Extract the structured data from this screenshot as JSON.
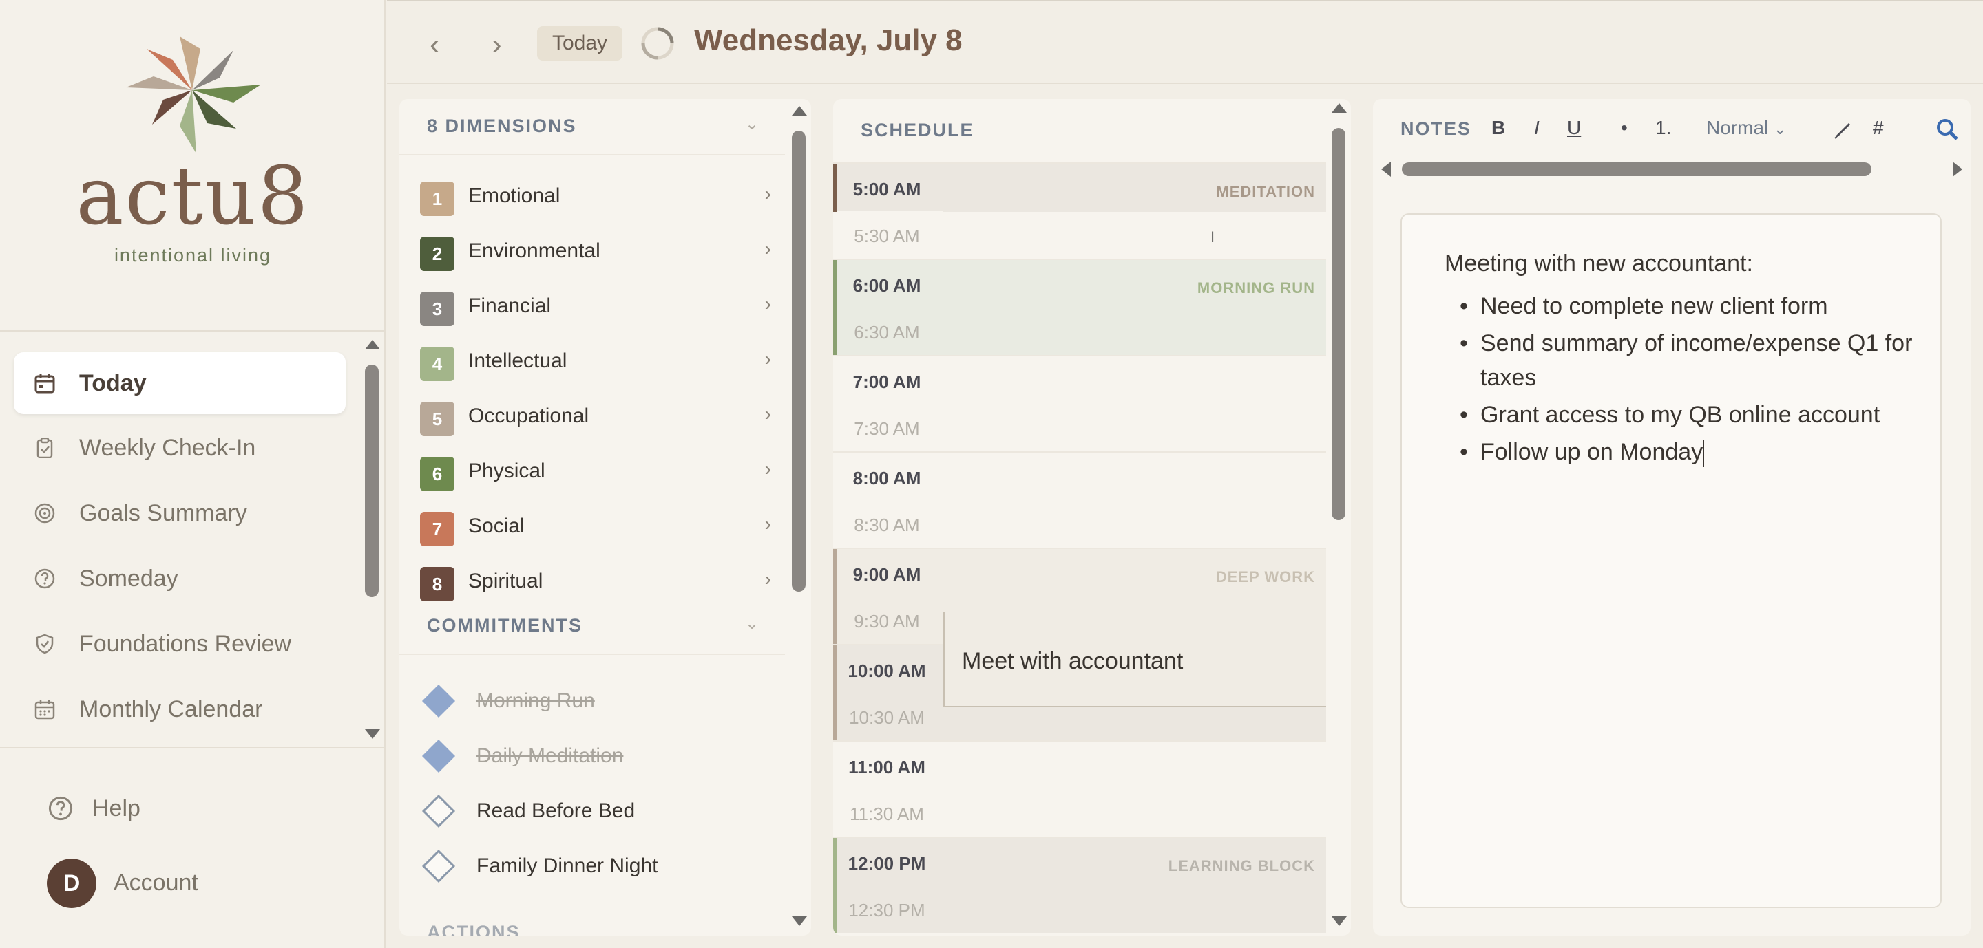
{
  "brand": {
    "name": "actu8",
    "tagline": "intentional living"
  },
  "sidebar": {
    "nav": [
      {
        "label": "Today",
        "icon": "calendar-icon",
        "active": true
      },
      {
        "label": "Weekly Check-In",
        "icon": "clipboard-check-icon"
      },
      {
        "label": "Goals Summary",
        "icon": "target-icon"
      },
      {
        "label": "Someday",
        "icon": "question-circle-icon"
      },
      {
        "label": "Foundations Review",
        "icon": "shield-check-icon"
      },
      {
        "label": "Monthly Calendar",
        "icon": "calendar-grid-icon"
      }
    ],
    "help": "Help",
    "account": "Account",
    "avatar_initial": "D"
  },
  "topbar": {
    "prev": "‹",
    "next": "›",
    "today": "Today",
    "date": "Wednesday, July 8"
  },
  "dimensions": {
    "header": "8 DIMENSIONS",
    "items": [
      {
        "num": "1",
        "label": "Emotional",
        "color": "#c6a98a"
      },
      {
        "num": "2",
        "label": "Environmental",
        "color": "#4f5e3c"
      },
      {
        "num": "3",
        "label": "Financial",
        "color": "#8a8682"
      },
      {
        "num": "4",
        "label": "Intellectual",
        "color": "#a3b58a"
      },
      {
        "num": "5",
        "label": "Occupational",
        "color": "#b8a898"
      },
      {
        "num": "6",
        "label": "Physical",
        "color": "#6e8a4e"
      },
      {
        "num": "7",
        "label": "Social",
        "color": "#c8785a"
      },
      {
        "num": "8",
        "label": "Spiritual",
        "color": "#6b4a3e"
      }
    ]
  },
  "commitments": {
    "header": "COMMITMENTS",
    "items": [
      {
        "label": "Morning Run",
        "done": true
      },
      {
        "label": "Daily Meditation",
        "done": true
      },
      {
        "label": "Read Before Bed",
        "done": false
      },
      {
        "label": "Family Dinner Night",
        "done": false
      }
    ],
    "next_header_partial": "ACTIONS"
  },
  "schedule": {
    "header": "SCHEDULE",
    "slots": [
      {
        "time": "5:00 AM",
        "hour": true,
        "tag": "MEDITATION",
        "tag_color": "#a8998a",
        "bar": "#7a5e4c",
        "fill": "#ebe7e0"
      },
      {
        "time": "5:30 AM",
        "hour": false,
        "tag": "",
        "bar": "",
        "fill": ""
      },
      {
        "time": "6:00 AM",
        "hour": true,
        "tag": "MORNING RUN",
        "tag_color": "#a3b58a",
        "bar": "#8aa070",
        "fill": "#e9ebe2"
      },
      {
        "time": "6:30 AM",
        "hour": false,
        "tag": "",
        "bar": "#8aa070",
        "fill": "#e9ebe2"
      },
      {
        "time": "7:00 AM",
        "hour": true,
        "tag": "",
        "bar": "",
        "fill": ""
      },
      {
        "time": "7:30 AM",
        "hour": false,
        "tag": "",
        "bar": "",
        "fill": ""
      },
      {
        "time": "8:00 AM",
        "hour": true,
        "tag": "",
        "bar": "",
        "fill": ""
      },
      {
        "time": "8:30 AM",
        "hour": false,
        "tag": "",
        "bar": "",
        "fill": ""
      },
      {
        "time": "9:00 AM",
        "hour": true,
        "tag": "DEEP WORK",
        "tag_color": "#c8c0b2",
        "bar": "#b8a898",
        "fill": "#f0ece4"
      },
      {
        "time": "9:30 AM",
        "hour": false,
        "tag": "",
        "bar": "#b8a898",
        "fill": "#f0ece4"
      },
      {
        "time": "10:00 AM",
        "hour": true,
        "tag": "",
        "bar": "#b8a898",
        "fill": "#ebe7e0"
      },
      {
        "time": "10:30 AM",
        "hour": false,
        "tag": "",
        "bar": "#b8a898",
        "fill": "#ebe7e0"
      },
      {
        "time": "11:00 AM",
        "hour": true,
        "tag": "",
        "bar": "",
        "fill": ""
      },
      {
        "time": "11:30 AM",
        "hour": false,
        "tag": "",
        "bar": "",
        "fill": ""
      },
      {
        "time": "12:00 PM",
        "hour": true,
        "tag": "LEARNING BLOCK",
        "tag_color": "#b8b4ac",
        "bar": "#a3b58a",
        "fill": "#ebe7e0"
      },
      {
        "time": "12:30 PM",
        "hour": false,
        "tag": "",
        "bar": "#a3b58a",
        "fill": "#ebe7e0"
      }
    ],
    "event": {
      "title": "Meet with accountant"
    }
  },
  "notes": {
    "header": "NOTES",
    "toolbar": {
      "bold": "B",
      "italic": "I",
      "underline": "U",
      "bullet": "•",
      "ordered": "1.",
      "style": "Normal",
      "hash": "#"
    },
    "heading": "Meeting with new accountant:",
    "bullets": [
      "Need to complete new client form",
      "Send summary of income/expense Q1 for taxes",
      "Grant access to my QB online account",
      "Follow up on Monday"
    ]
  }
}
